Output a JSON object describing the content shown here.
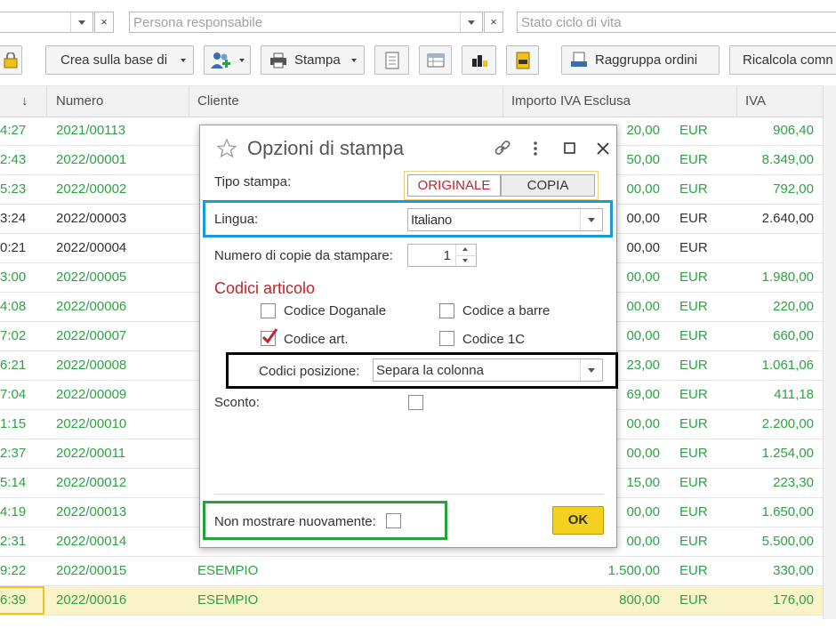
{
  "filters": {
    "persona_placeholder": "Persona responsabile",
    "stato_placeholder": "Stato ciclo di vita",
    "clear_glyph": "×"
  },
  "toolbar": {
    "crea_label": "Crea sulla base di",
    "stampa_label": "Stampa",
    "raggruppa_label": "Raggruppa ordini",
    "ricalcola_label": "Ricalcola comn"
  },
  "table": {
    "sort_glyph": "↓",
    "columns": [
      "Numero",
      "Cliente",
      "Importo IVA Esclusa",
      "IVA"
    ],
    "rows": [
      {
        "time": "4:27",
        "numero": "2021/00113",
        "cliente": "",
        "importo": "20,00",
        "valuta": "EUR",
        "iva": "906,40",
        "status": "green"
      },
      {
        "time": "2:43",
        "numero": "2022/00001",
        "cliente": "",
        "importo": "50,00",
        "valuta": "EUR",
        "iva": "8.349,00",
        "status": "green"
      },
      {
        "time": "5:23",
        "numero": "2022/00002",
        "cliente": "",
        "importo": "00,00",
        "valuta": "EUR",
        "iva": "792,00",
        "status": "green"
      },
      {
        "time": "3:24",
        "numero": "2022/00003",
        "cliente": "",
        "importo": "00,00",
        "valuta": "EUR",
        "iva": "2.640,00",
        "status": "dark"
      },
      {
        "time": "0:21",
        "numero": "2022/00004",
        "cliente": "",
        "importo": "00,00",
        "valuta": "EUR",
        "iva": "",
        "status": "dark"
      },
      {
        "time": "3:00",
        "numero": "2022/00005",
        "cliente": "",
        "importo": "00,00",
        "valuta": "EUR",
        "iva": "1.980,00",
        "status": "green"
      },
      {
        "time": "4:08",
        "numero": "2022/00006",
        "cliente": "",
        "importo": "00,00",
        "valuta": "EUR",
        "iva": "220,00",
        "status": "green"
      },
      {
        "time": "7:02",
        "numero": "2022/00007",
        "cliente": "",
        "importo": "00,00",
        "valuta": "EUR",
        "iva": "660,00",
        "status": "green"
      },
      {
        "time": "6:21",
        "numero": "2022/00008",
        "cliente": "",
        "importo": "23,00",
        "valuta": "EUR",
        "iva": "1.061,06",
        "status": "green"
      },
      {
        "time": "7:04",
        "numero": "2022/00009",
        "cliente": "",
        "importo": "69,00",
        "valuta": "EUR",
        "iva": "411,18",
        "status": "green"
      },
      {
        "time": "1:15",
        "numero": "2022/00010",
        "cliente": "",
        "importo": "00,00",
        "valuta": "EUR",
        "iva": "2.200,00",
        "status": "green"
      },
      {
        "time": "2:37",
        "numero": "2022/00011",
        "cliente": "",
        "importo": "00,00",
        "valuta": "EUR",
        "iva": "1.254,00",
        "status": "green"
      },
      {
        "time": "5:14",
        "numero": "2022/00012",
        "cliente": "",
        "importo": "15,00",
        "valuta": "EUR",
        "iva": "223,30",
        "status": "green"
      },
      {
        "time": "4:19",
        "numero": "2022/00013",
        "cliente": "",
        "importo": "00,00",
        "valuta": "EUR",
        "iva": "1.650,00",
        "status": "green"
      },
      {
        "time": "2:31",
        "numero": "2022/00014",
        "cliente": "",
        "importo": "00,00",
        "valuta": "EUR",
        "iva": "5.500,00",
        "status": "green"
      },
      {
        "time": "9:22",
        "numero": "2022/00015",
        "cliente": "ESEMPIO",
        "importo": "1.500,00",
        "valuta": "EUR",
        "iva": "330,00",
        "status": "green"
      },
      {
        "time": "6:39",
        "numero": "2022/00016",
        "cliente": "ESEMPIO",
        "importo": "800,00",
        "valuta": "EUR",
        "iva": "176,00",
        "status": "green",
        "selected": true
      }
    ]
  },
  "dialog": {
    "title": "Opzioni di stampa",
    "tipo_label": "Tipo stampa:",
    "originale": "ORIGINALE",
    "copia": "COPIA",
    "lingua_label": "Lingua:",
    "lingua_value": "Italiano",
    "copie_label": "Numero di copie da stampare:",
    "copie_value": "1",
    "codici_heading": "Codici articolo",
    "cb_doganale": "Codice Doganale",
    "cb_barre": "Codice a barre",
    "cb_art": "Codice art.",
    "cb_1c": "Codice 1C",
    "posizione_label": "Codici posizione:",
    "posizione_value": "Separa la colonna",
    "sconto_label": "Sconto:",
    "non_mostrare_label": "Non mostrare nuovamente:",
    "ok_label": "OK"
  },
  "colors": {
    "green_text": "#2ea244",
    "accent_red": "#c0252b",
    "ok_yellow": "#f5d11f",
    "frame_blue": "#1a9ad6",
    "frame_green": "#27a23a",
    "frame_black": "#000000"
  }
}
